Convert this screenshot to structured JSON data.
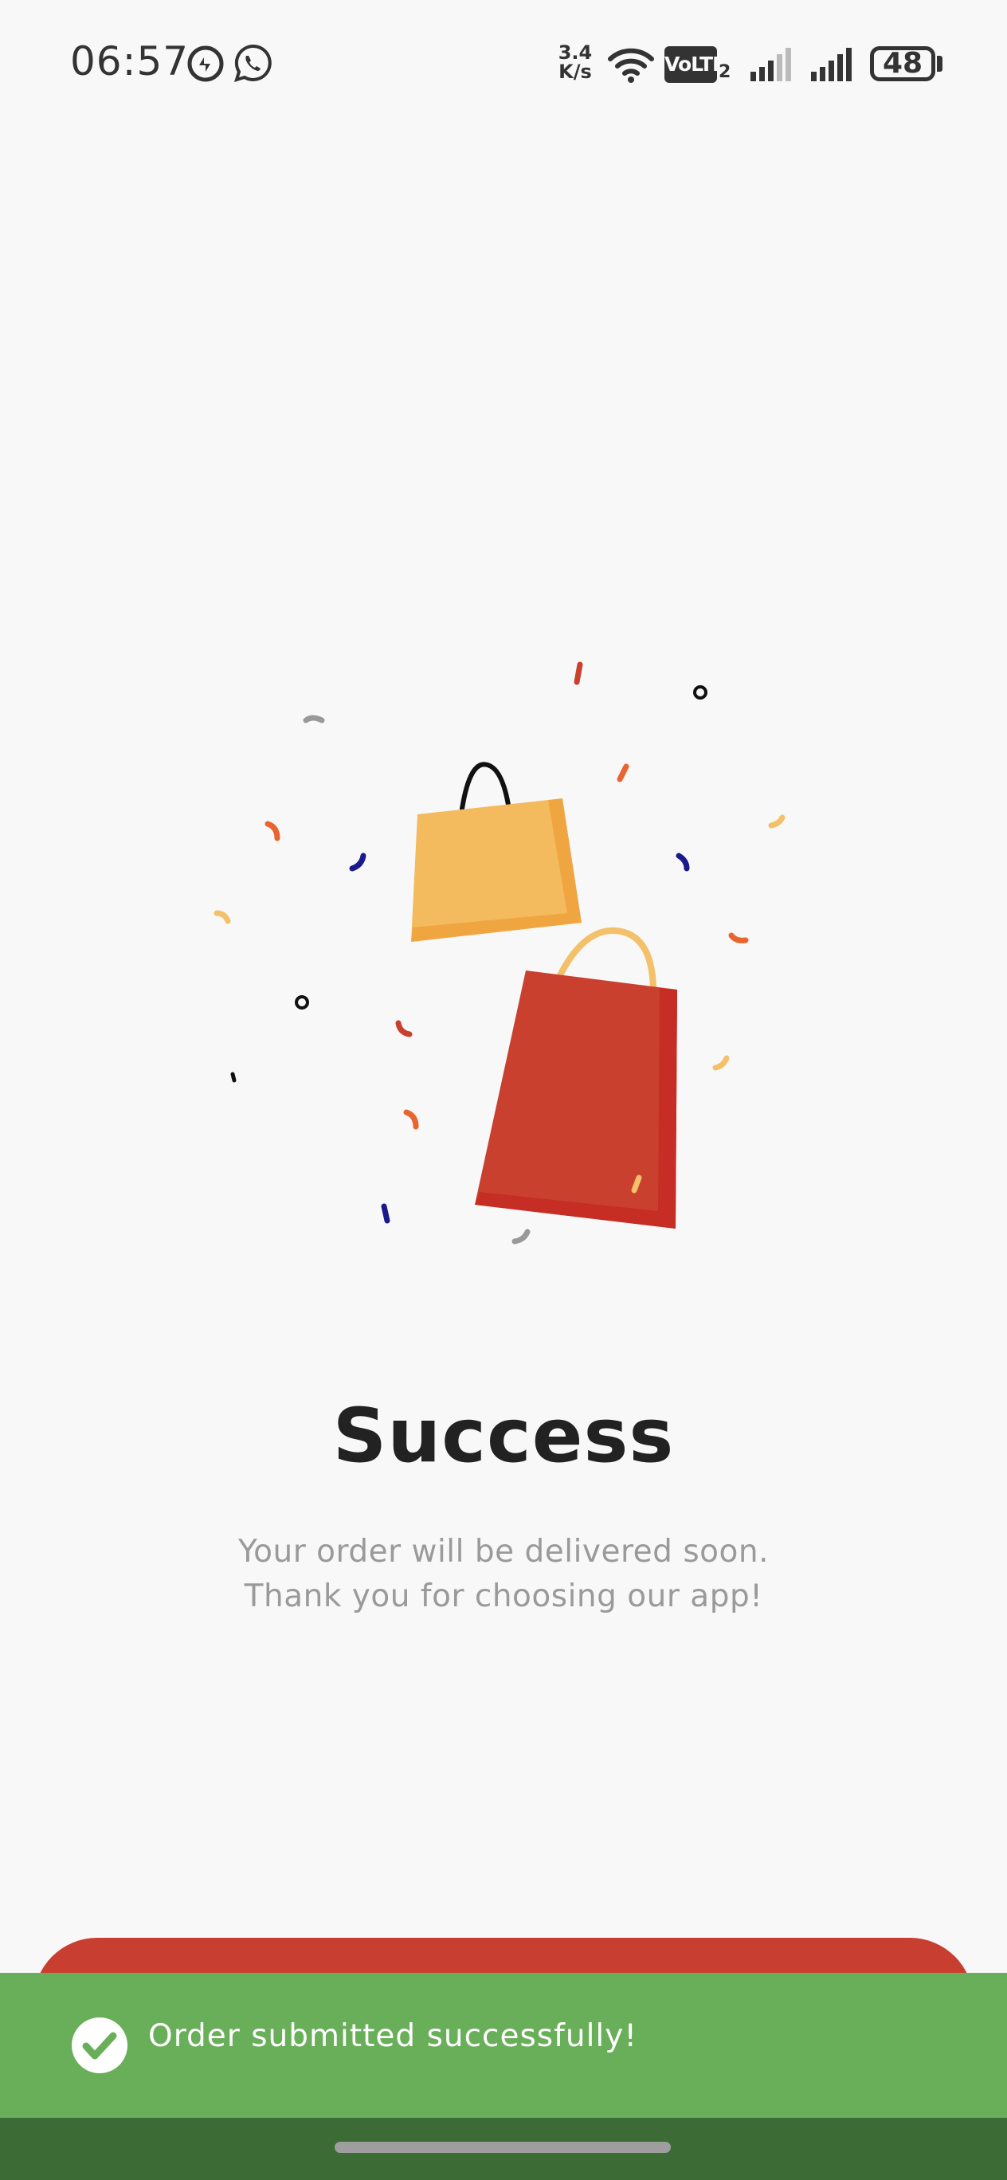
{
  "status_bar": {
    "time": "06:57",
    "net_speed_value": "3.4",
    "net_speed_unit": "K/s",
    "volte": "VoLTE",
    "volte_sim": "2",
    "battery": "48"
  },
  "main": {
    "title": "Success",
    "message_line1": "Your order will be delivered soon.",
    "message_line2": "Thank you for choosing our app!"
  },
  "toast": {
    "message": "Order submitted successfully!"
  },
  "colors": {
    "background": "#f8f8f8",
    "accent_red": "#c83f31",
    "toast_green": "#69ae59",
    "nav_green": "#3d6b35",
    "bag_yellow": "#f4ba5e"
  },
  "icons": {
    "data_saver": "data-saver-icon",
    "whatsapp": "whatsapp-icon",
    "wifi": "wifi-icon",
    "signal": "signal-icon",
    "battery": "battery-icon",
    "check": "check-icon"
  }
}
